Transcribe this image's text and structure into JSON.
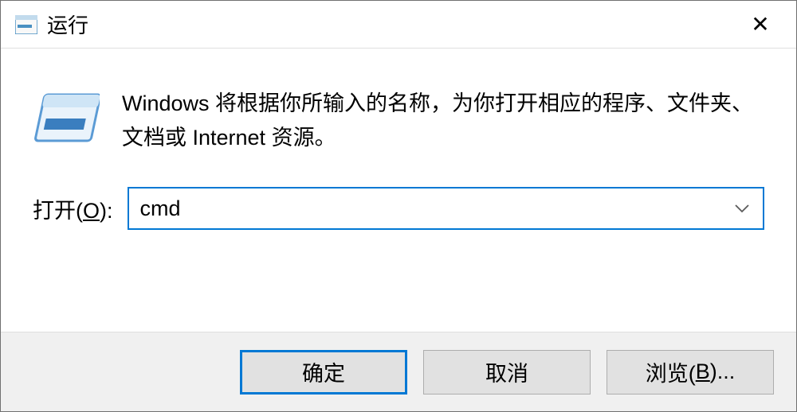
{
  "titlebar": {
    "title": "运行"
  },
  "body": {
    "description": "Windows 将根据你所输入的名称，为你打开相应的程序、文件夹、文档或 Internet 资源。",
    "open_label_prefix": "打开(",
    "open_label_hotkey": "O",
    "open_label_suffix": "):",
    "input_value": "cmd"
  },
  "buttons": {
    "ok": "确定",
    "cancel": "取消",
    "browse_prefix": "浏览(",
    "browse_hotkey": "B",
    "browse_suffix": ")..."
  }
}
